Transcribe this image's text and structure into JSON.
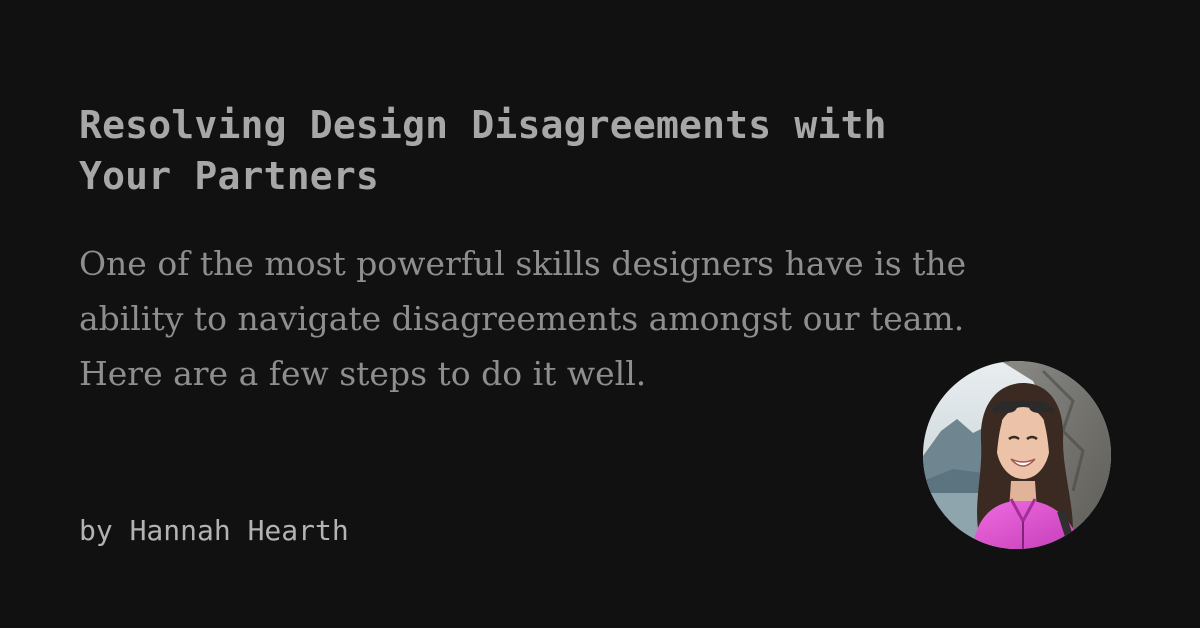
{
  "post": {
    "title_line1": "Resolving Design Disagreements with",
    "title_line2": "Your Partners",
    "description_line1": "One of the most powerful skills designers have is the",
    "description_line2": "ability to navigate disagreements amongst our team.",
    "description_line3": "Here are a few steps to do it well.",
    "author": "by Hannah Hearth"
  },
  "colors": {
    "background": "#111112",
    "title": "#a7a7a7",
    "description": "#8e8e8e",
    "author": "#b3b3b3"
  }
}
